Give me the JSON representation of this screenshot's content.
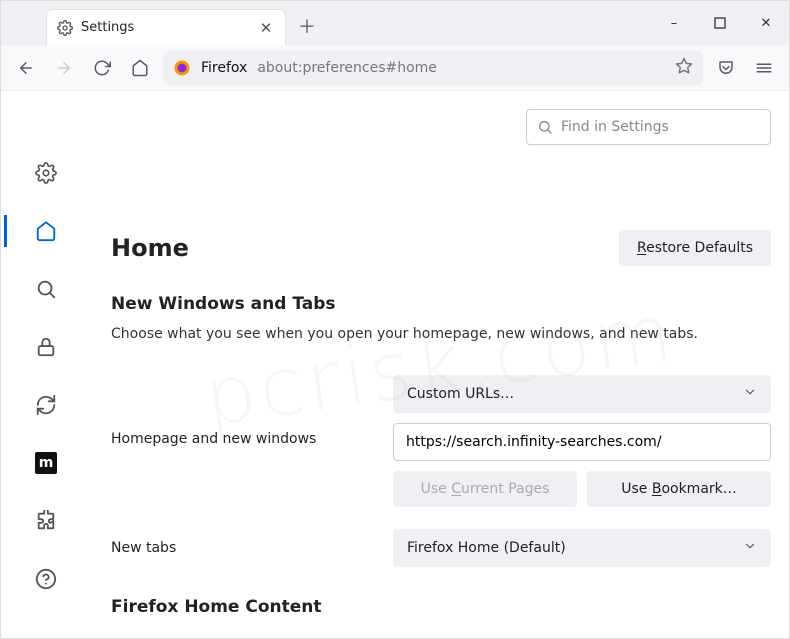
{
  "window": {
    "tab_title": "Settings",
    "minimize": "–",
    "maximize": "☐",
    "close": "✕"
  },
  "toolbar": {
    "firefox_label": "Firefox",
    "address": "about:preferences#home"
  },
  "search_box": {
    "placeholder": "Find in Settings"
  },
  "page": {
    "title": "Home",
    "restore_btn_prefix": "R",
    "restore_btn_rest": "estore Defaults"
  },
  "section_new_wt": {
    "heading": "New Windows and Tabs",
    "description": "Choose what you see when you open your homepage, new windows, and new tabs."
  },
  "homepage": {
    "label": "Homepage and new windows",
    "select_label": "Custom URLs…",
    "url_value": "https://search.infinity-searches.com/",
    "use_current_pre": "Use ",
    "use_current_u": "C",
    "use_current_post": "urrent Pages",
    "use_bookmark_pre": "Use ",
    "use_bookmark_u": "B",
    "use_bookmark_post": "ookmark…"
  },
  "new_tabs": {
    "label": "New tabs",
    "select_label": "Firefox Home (Default)"
  },
  "fhc": {
    "heading": "Firefox Home Content"
  },
  "new_tab_plus": "＋"
}
